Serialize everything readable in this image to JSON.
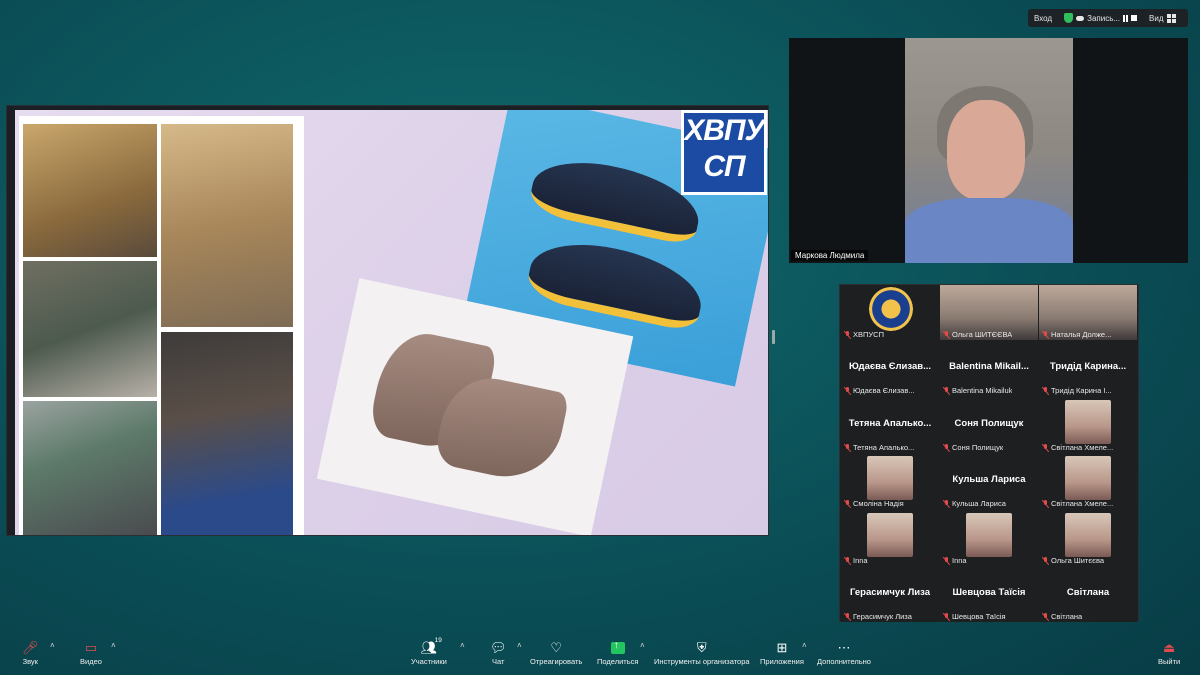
{
  "status_bar": {
    "login": "Вход",
    "recording": "Запись...",
    "view": "Вид"
  },
  "slide": {
    "logo_line1": "ХВПУ",
    "logo_line2": "СП"
  },
  "presenter": {
    "name": "Маркова Людмила"
  },
  "participants": [
    {
      "big": "",
      "small": "ХВПУСП",
      "thumb": "logo"
    },
    {
      "big": "",
      "small": "Ольга ШИТЄЄВА",
      "thumb": "wide"
    },
    {
      "big": "",
      "small": "Наталья Долже...",
      "thumb": "wide"
    },
    {
      "big": "Юдаєва Єлизав...",
      "small": "Юдаєва Єлизав...",
      "thumb": ""
    },
    {
      "big": "Balentina Mikail...",
      "small": "Balentina Mikailuk",
      "thumb": ""
    },
    {
      "big": "Тридід Карина...",
      "small": "Тридід Карина І...",
      "thumb": ""
    },
    {
      "big": "Тетяна Апалько...",
      "small": "Тетяна Апалько...",
      "thumb": ""
    },
    {
      "big": "Соня Полищук",
      "small": "Соня Полищук",
      "thumb": ""
    },
    {
      "big": "",
      "small": "Світлана Хмеле...",
      "thumb": "face"
    },
    {
      "big": "",
      "small": "Смоліна Надія",
      "thumb": "face"
    },
    {
      "big": "Кульша Лариса",
      "small": "Кульша Лариса",
      "thumb": ""
    },
    {
      "big": "",
      "small": "Світлана Хмеле...",
      "thumb": "face"
    },
    {
      "big": "",
      "small": "Inna",
      "thumb": "face"
    },
    {
      "big": "",
      "small": "Inna",
      "thumb": "face"
    },
    {
      "big": "",
      "small": "Ольга Шитєєва",
      "thumb": "face"
    },
    {
      "big": "Герасимчук Лиза",
      "small": "Герасимчук Лиза",
      "thumb": ""
    },
    {
      "big": "Шевцова Таїсія",
      "small": "Шевцова Таїсія",
      "thumb": ""
    },
    {
      "big": "Світлана",
      "small": "Світлана",
      "thumb": ""
    }
  ],
  "toolbar": {
    "audio": "Звук",
    "video": "Видео",
    "participants": "Участники",
    "participants_count": "19",
    "chat": "Чат",
    "react": "Отреагировать",
    "share": "Поделиться",
    "host_tools": "Инструменты организатора",
    "apps": "Приложения",
    "more": "Дополнительно",
    "leave": "Выйти"
  }
}
